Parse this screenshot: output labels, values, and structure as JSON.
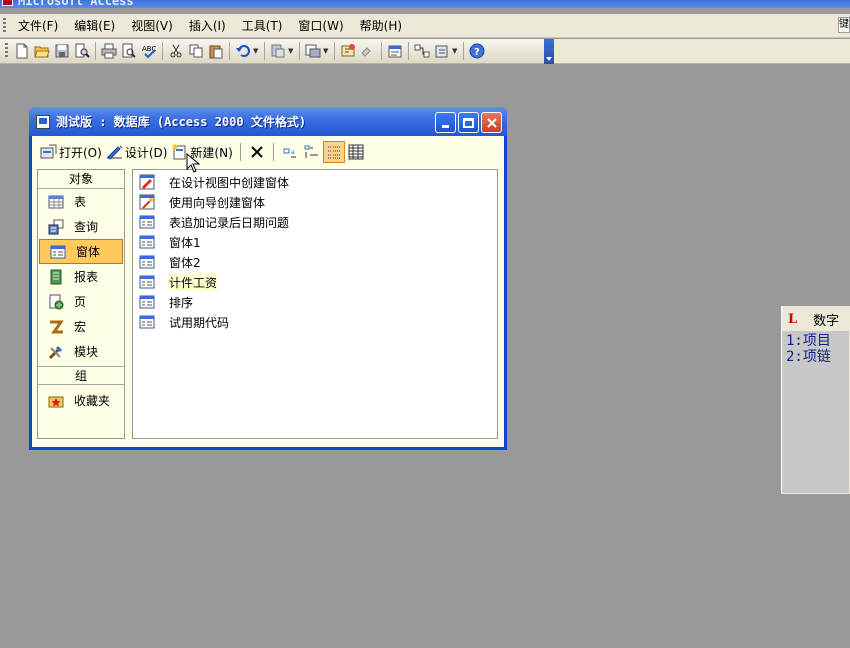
{
  "app": {
    "title": "Microsoft Access"
  },
  "menu": [
    {
      "label": "文件(F)"
    },
    {
      "label": "编辑(E)"
    },
    {
      "label": "视图(V)"
    },
    {
      "label": "插入(I)"
    },
    {
      "label": "工具(T)"
    },
    {
      "label": "窗口(W)"
    },
    {
      "label": "帮助(H)"
    }
  ],
  "menu_right_text": "键",
  "toolbar_icons": [
    "new-icon",
    "open-icon",
    "save-icon",
    "search-file-icon",
    "print-icon",
    "print-preview-icon",
    "spelling-icon",
    "cut-icon",
    "copy-icon",
    "paste-icon",
    "undo-icon",
    "office-links-icon",
    "analyze-icon",
    "code-icon",
    "script-icon",
    "properties-icon",
    "relationships-icon",
    "new-object-icon",
    "help-icon"
  ],
  "db_window": {
    "title": "测试版 : 数据库 (Access 2000 文件格式)",
    "toolbar": {
      "open": "打开(O)",
      "design": "设计(D)",
      "new": "新建(N)"
    },
    "objects_header": "对象",
    "objects": [
      {
        "label": "表",
        "icon": "table-icon"
      },
      {
        "label": "查询",
        "icon": "query-icon"
      },
      {
        "label": "窗体",
        "icon": "form-icon",
        "selected": true
      },
      {
        "label": "报表",
        "icon": "report-icon"
      },
      {
        "label": "页",
        "icon": "page-icon"
      },
      {
        "label": "宏",
        "icon": "macro-icon"
      },
      {
        "label": "模块",
        "icon": "module-icon"
      }
    ],
    "groups_header": "组",
    "groups": [
      {
        "label": "收藏夹",
        "icon": "favorites-icon"
      }
    ],
    "items": [
      {
        "label": "在设计视图中创建窗体",
        "icon": "wizard-design-icon"
      },
      {
        "label": "使用向导创建窗体",
        "icon": "wizard-icon"
      },
      {
        "label": "表追加记录后日期问题",
        "icon": "form-icon"
      },
      {
        "label": "窗体1",
        "icon": "form-icon"
      },
      {
        "label": "窗体2",
        "icon": "form-icon"
      },
      {
        "label": "计件工资",
        "icon": "form-icon",
        "highlighted": true
      },
      {
        "label": "排序",
        "icon": "form-icon"
      },
      {
        "label": "试用期代码",
        "icon": "form-icon"
      }
    ]
  },
  "side_window": {
    "title": "数字",
    "lines": [
      "1:项目",
      "2:项链"
    ]
  }
}
